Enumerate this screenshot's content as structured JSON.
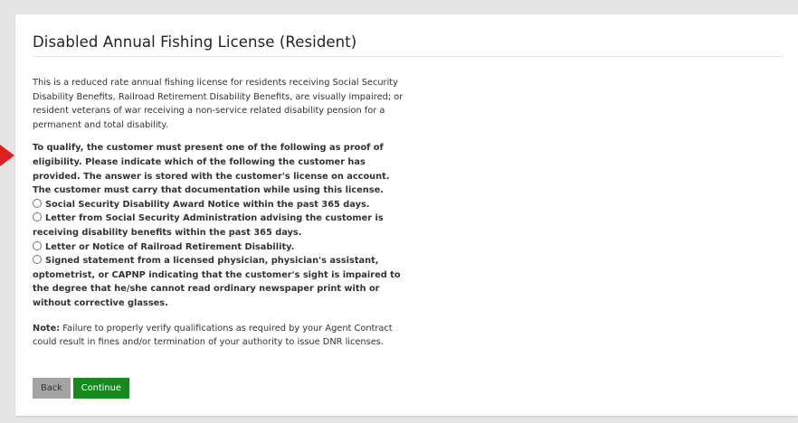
{
  "page": {
    "title": "Disabled Annual Fishing License (Resident)",
    "intro": "This is a reduced rate annual fishing license for residents receiving Social Security Disability Benefits, Railroad Retirement Disability Benefits, are visually impaired; or resident veterans of war receiving a non-service related disability pension for a permanent and total disability.",
    "qualify": "To qualify, the customer must present one of the following as proof of eligibility. Please indicate which of the following the customer has provided. The answer is stored with the customer's license on account. The customer must carry that documentation while using this license.",
    "options": [
      "Social Security Disability Award Notice within the past 365 days.",
      "Letter from Social Security Administration advising the customer is receiving disability benefits within the past 365 days.",
      "Letter or Notice of Railroad Retirement Disability.",
      "Signed statement from a licensed physician, physician's assistant, optometrist, or CAPNP indicating that the customer's sight is impaired to the degree that he/she cannot read ordinary newspaper print with or without corrective glasses."
    ],
    "note_label": "Note:",
    "note_text": " Failure to properly verify qualifications as required by your Agent Contract could result in fines and/or termination of your authority to issue DNR licenses."
  },
  "buttons": {
    "back": "Back",
    "continue": "Continue"
  },
  "colors": {
    "accent_arrow": "#e02020",
    "continue_button": "#16891f",
    "back_button": "#a3a3a3"
  }
}
